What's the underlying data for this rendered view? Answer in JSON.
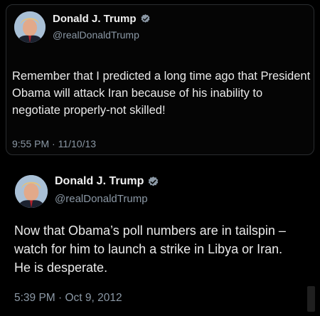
{
  "tweets": [
    {
      "display_name": "Donald J. Trump",
      "handle": "@realDonaldTrump",
      "text": "Remember that I predicted a long time ago that President Obama will attack Iran because of his inability to negotiate properly-not skilled!",
      "timestamp": "9:55 PM · 11/10/13"
    },
    {
      "display_name": "Donald J. Trump",
      "handle": "@realDonaldTrump",
      "text": "Now that Obama’s poll numbers are in tailspin – watch for him to launch a strike in Libya or Iran.  He is desperate.",
      "timestamp": "5:39 PM · Oct 9, 2012"
    }
  ],
  "colors": {
    "background": "#000000",
    "verified_badge": "#8b98a5",
    "muted_text": "#8b98a5",
    "primary_text": "#e7e9ea"
  },
  "icons": [
    "verified-badge-icon",
    "avatar"
  ]
}
